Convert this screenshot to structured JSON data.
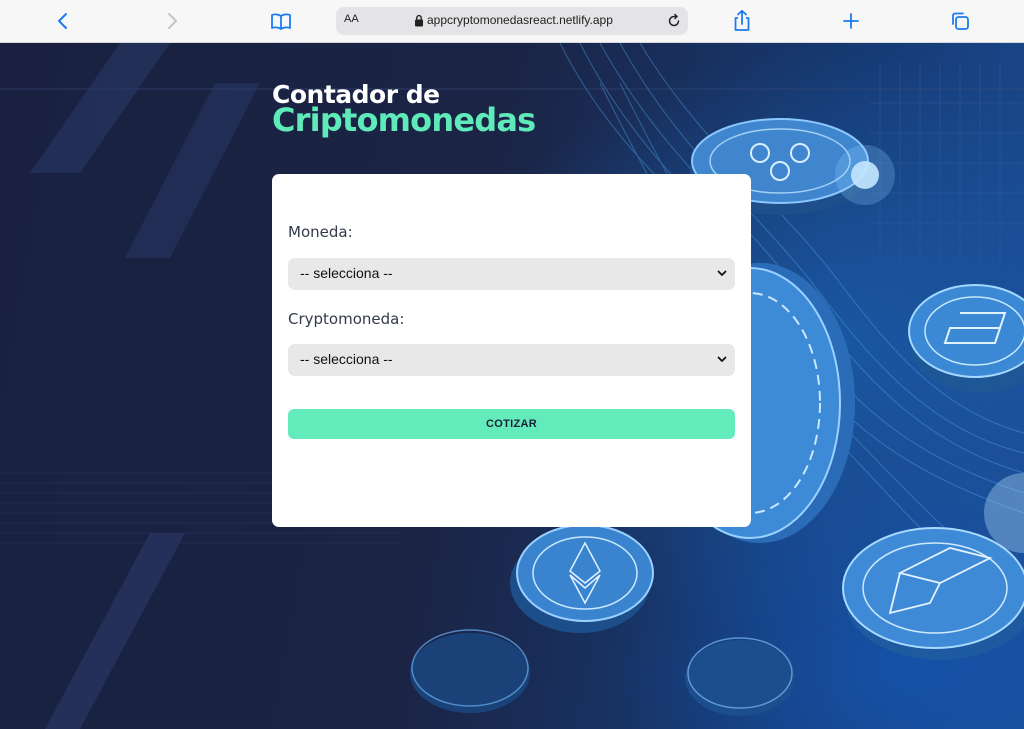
{
  "browser": {
    "address_small_label": "AA",
    "url": "appcryptomonedasreact.netlify.app",
    "icons": [
      "back-icon",
      "forward-icon",
      "bookmarks-icon",
      "lock-icon",
      "reload-icon",
      "share-icon",
      "new-tab-icon",
      "tabs-icon"
    ]
  },
  "header": {
    "line1": "Contador de",
    "line2": "Criptomonedas"
  },
  "form": {
    "currency_label": "Moneda:",
    "currency_selected": "-- selecciona --",
    "crypto_label": "Cryptomoneda:",
    "crypto_selected": "-- selecciona --",
    "submit_label": "COTIZAR"
  },
  "colors": {
    "accent": "#63ebbc",
    "title_accent": "#5eeab9",
    "background": "#1b2340",
    "card": "#ffffff"
  }
}
